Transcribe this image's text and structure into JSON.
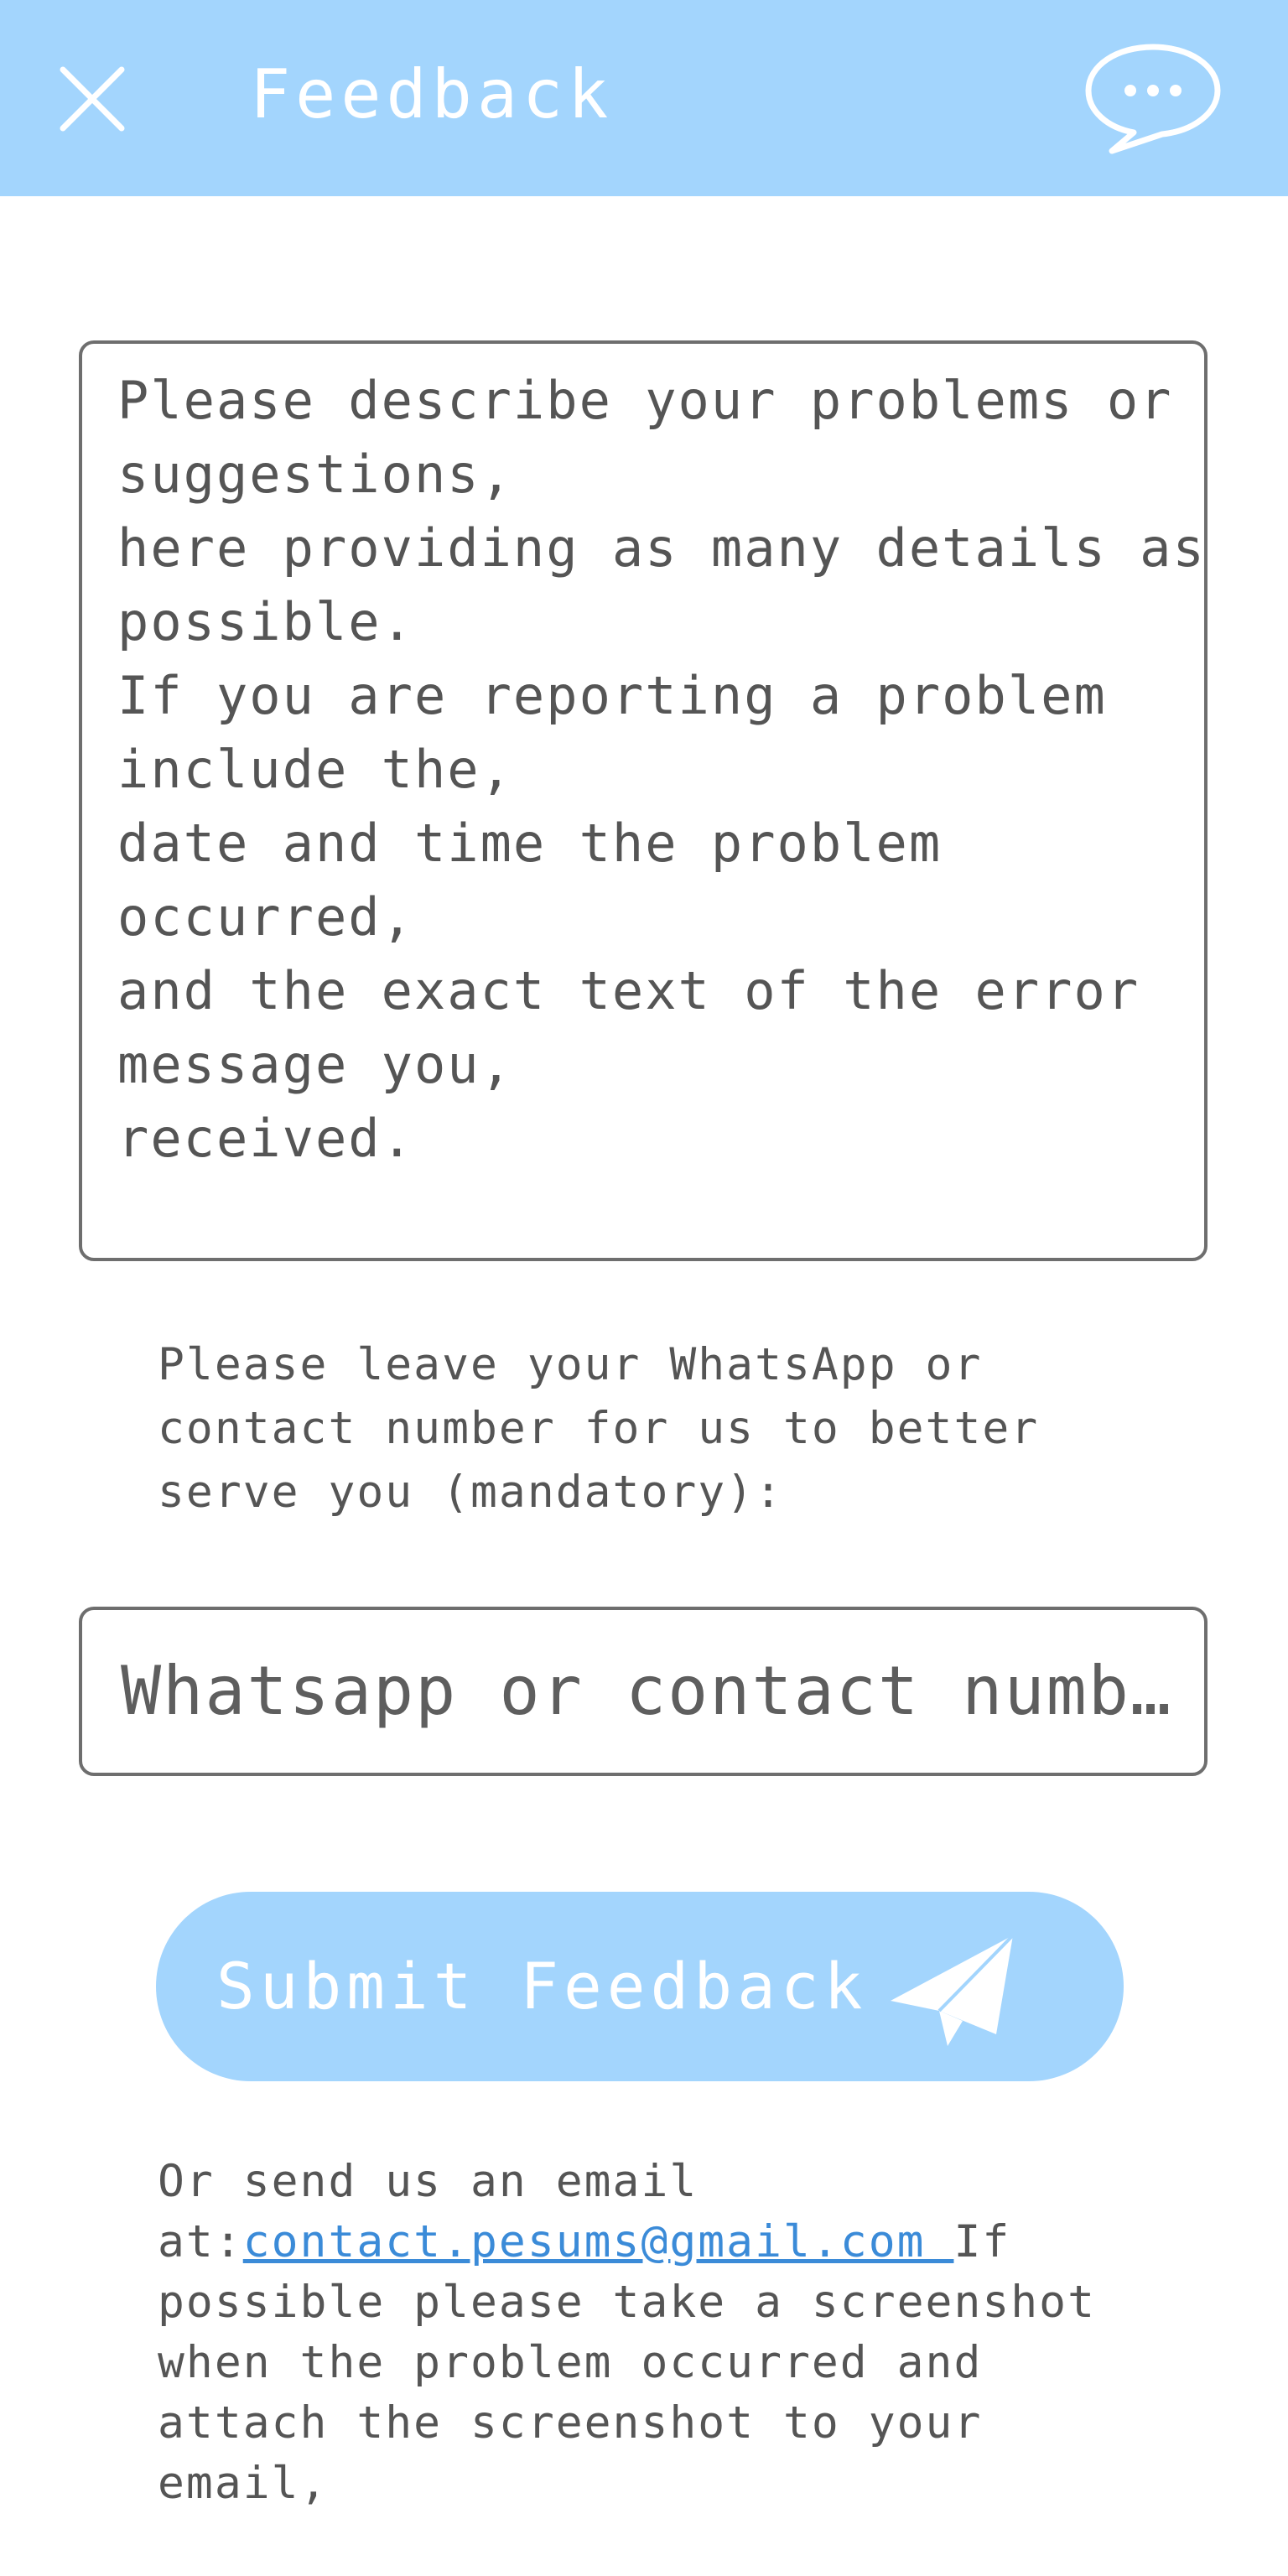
{
  "header": {
    "title": "Feedback",
    "background_color": "#a3d5fd",
    "close_icon": "close-icon",
    "chat_icon": "chat-bubble-icon"
  },
  "description": {
    "placeholder": "Please describe your problems or suggestions,\nhere providing as many details as possible.\nIf you are reporting a problem include the,\ndate and time the problem occurred,\nand the exact text of the error message you,\nreceived.",
    "value": ""
  },
  "contact": {
    "prompt": "Please leave your WhatsApp or contact number for us to better serve you (mandatory):",
    "placeholder": "Whatsapp or contact number",
    "value": ""
  },
  "submit": {
    "label": "Submit Feedback",
    "icon": "send-icon",
    "background_color": "#a3d5fd"
  },
  "email_note": {
    "prefix": "Or send us an email at:",
    "email": "contact.pesums@gmail.com ",
    "suffix": "If possible please take a screenshot when the problem occurred and attach the screenshot to your email,",
    "link_color": "#3b8bd8"
  }
}
